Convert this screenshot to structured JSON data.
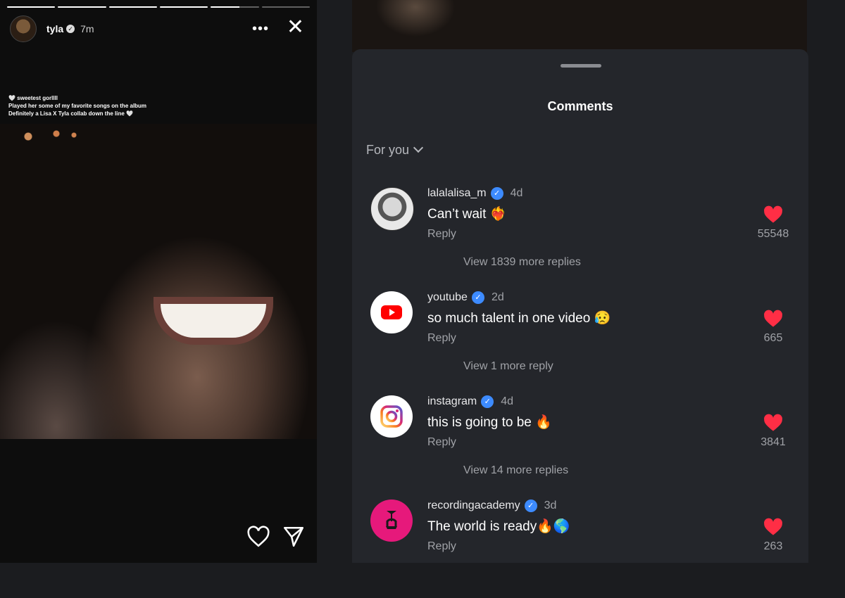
{
  "story": {
    "username": "tyla",
    "time": "7m",
    "more_icon": "more-dots-icon",
    "close_icon": "close-icon",
    "caption_lines": [
      "🤍 sweetest gorllll",
      "Played her some of my favorite songs on the album",
      "Definitely a Lisa X Tyla collab down the line 🤍"
    ],
    "progress": [
      1,
      1,
      1,
      1,
      0.6,
      0
    ]
  },
  "comments": {
    "title": "Comments",
    "filter": "For you",
    "items": [
      {
        "user": "lalalalisa_m",
        "time": "4d",
        "text": "Can’t wait ❤️‍🔥",
        "reply": "Reply",
        "likes": "55548",
        "view_more": "View 1839 more replies"
      },
      {
        "user": "youtube",
        "time": "2d",
        "text": "so much talent in one video 😥",
        "reply": "Reply",
        "likes": "665",
        "view_more": "View 1 more reply"
      },
      {
        "user": "instagram",
        "time": "4d",
        "text": "this is going to be 🔥",
        "reply": "Reply",
        "likes": "3841",
        "view_more": "View 14 more replies"
      },
      {
        "user": "recordingacademy",
        "time": "3d",
        "text": "The world is ready🔥🌎",
        "reply": "Reply",
        "likes": "263",
        "view_more": ""
      }
    ]
  },
  "colors": {
    "like": "#ff2e45",
    "verified": "#3d8bff",
    "sheet": "#24262b"
  }
}
